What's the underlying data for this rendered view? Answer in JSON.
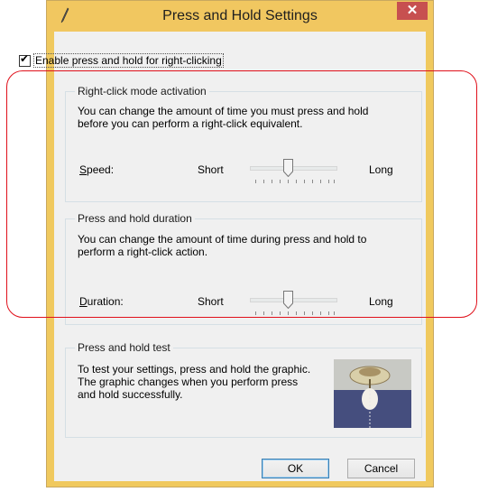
{
  "window": {
    "title": "Press and Hold Settings",
    "close_glyph": "✕"
  },
  "enable_checkbox": {
    "label": "Enable press and hold for right-clicking",
    "checked": true
  },
  "rightclick_group": {
    "title": "Right-click mode activation",
    "description_line1": "You can change the amount of time you must press and hold",
    "description_line2": "before you can perform a right-click equivalent.",
    "slider_label": "Speed:",
    "min_label": "Short",
    "max_label": "Long",
    "value_fraction": 0.43
  },
  "duration_group": {
    "title": "Press and hold duration",
    "description_line1": "You can change the amount of time during press and hold to",
    "description_line2": "perform a right-click action.",
    "slider_label": "Duration:",
    "min_label": "Short",
    "max_label": "Long",
    "value_fraction": 0.43
  },
  "test_group": {
    "title": "Press and hold test",
    "description_line1": "To test your settings, press and hold the graphic.",
    "description_line2": "The graphic changes when you perform press",
    "description_line3": "and hold successfully."
  },
  "buttons": {
    "ok": "OK",
    "cancel": "Cancel"
  },
  "colors": {
    "accent_border": "#e0101b",
    "title_bar": "#f1c760",
    "close_button": "#c75050"
  }
}
